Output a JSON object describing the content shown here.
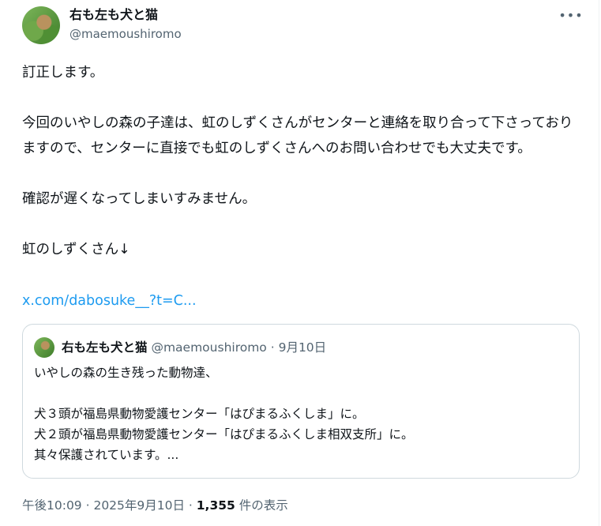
{
  "author": {
    "display_name": "右も左も犬と猫",
    "handle": "@maemoushiromo"
  },
  "more_icon": "more-horizontal-icon",
  "post_text": "訂正します。\n\n今回のいやしの森の子達は、虹のしずくさんがセンターと連絡を取り合って下さっておりますので、センターに直接でも虹のしずくさんへのお問い合わせでも大丈夫です。\n\n確認が遅くなってしまいすみません。\n\n虹のしずくさん↓",
  "post_link": "x.com/dabosuke__?t=C...",
  "quote": {
    "display_name": "右も左も犬と猫",
    "handle": "@maemoushiromo",
    "separator": " · ",
    "date": "9月10日",
    "text": "いやしの森の生き残った動物達、\n\n犬３頭が福島県動物愛護センター「はぴまるふくしま」に。\n犬２頭が福島県動物愛護センター「はぴまるふくしま相双支所」に。\n其々保護されています。..."
  },
  "footer": {
    "time": "午後10:09",
    "separator": " · ",
    "date": "2025年9月10日",
    "views_count": "1,355",
    "views_label": " 件の表示"
  }
}
